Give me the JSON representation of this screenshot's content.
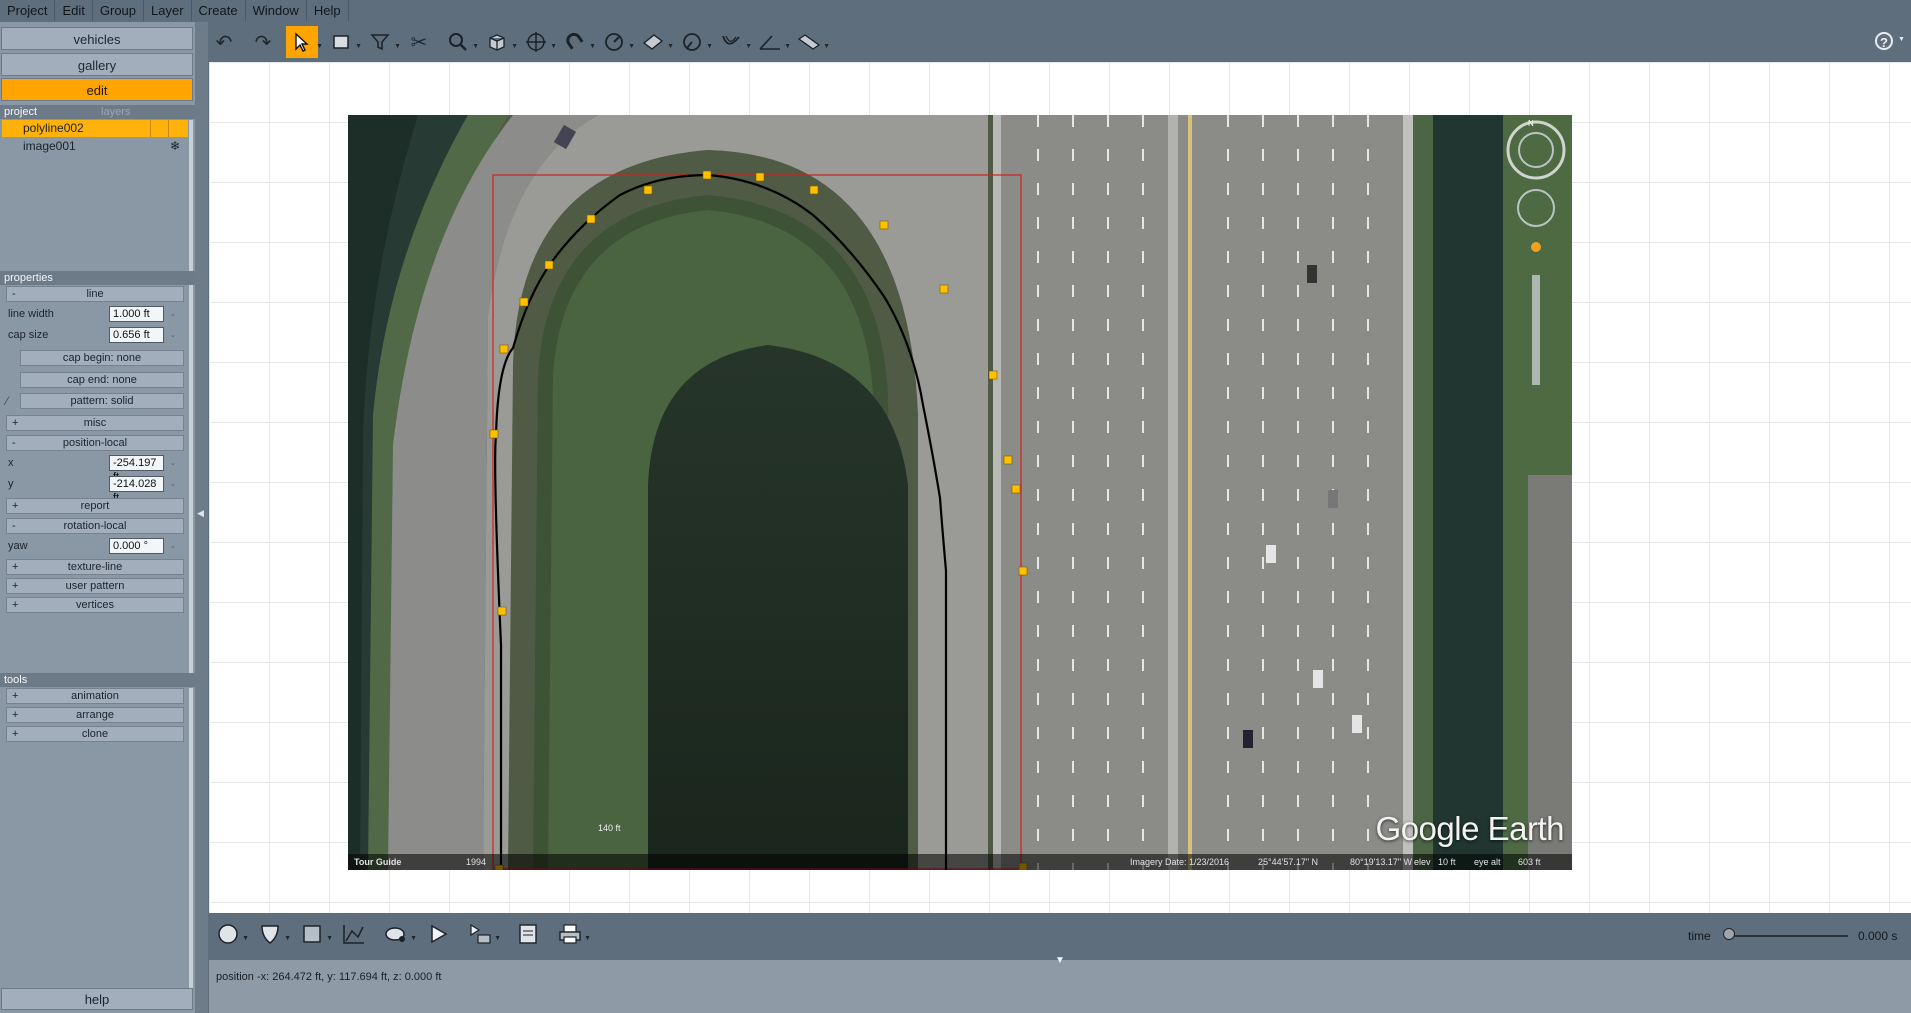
{
  "menu": [
    "Project",
    "Edit",
    "Group",
    "Layer",
    "Create",
    "Window",
    "Help"
  ],
  "nav": {
    "vehicles": "vehicles",
    "gallery": "gallery",
    "edit": "edit"
  },
  "project_panel": {
    "tab_project": "project",
    "tab_layers": "layers",
    "items": [
      {
        "label": "polyline002",
        "selected": true
      },
      {
        "label": "image001",
        "selected": false
      }
    ]
  },
  "properties": {
    "title": "properties",
    "line_group": "line",
    "line_width_label": "line width",
    "line_width_value": "1.000 ft",
    "cap_size_label": "cap size",
    "cap_size_value": "0.656 ft",
    "cap_begin": "cap begin: none",
    "cap_end": "cap end: none",
    "pattern": "pattern: solid",
    "misc": "misc",
    "position_local": "position-local",
    "x_label": "x",
    "x_value": "-254.197 ft",
    "y_label": "y",
    "y_value": "-214.028 ft",
    "report": "report",
    "rotation_local": "rotation-local",
    "yaw_label": "yaw",
    "yaw_value": "0.000 °",
    "texture_line": "texture-line",
    "user_pattern": "user pattern",
    "vertices": "vertices"
  },
  "tools_panel": {
    "title": "tools",
    "animation": "animation",
    "arrange": "arrange",
    "clone": "clone"
  },
  "help_label": "help",
  "time": {
    "label": "time",
    "value": "0.000 s",
    "position": 0.0
  },
  "status": "position -x: 264.472 ft, y: 117.694 ft, z: 0.000 ft",
  "google_earth": {
    "logo": "Google Earth",
    "tour_guide": "Tour Guide",
    "year": "1994",
    "scale": "140 ft",
    "imagery_date": "Imagery Date: 1/23/2016",
    "lat": "25°44'57.17\" N",
    "lon": "80°19'13.17\" W",
    "elev": "elev",
    "elev_value": "10 ft",
    "eye_alt": "eye alt",
    "eye_alt_value": "603 ft",
    "compass_n": "N"
  },
  "colors": {
    "accent": "#ffa400",
    "panel": "#8a97a4",
    "button": "#a2aebb",
    "polyline": "#000000",
    "vertex": "#ffc000",
    "bbox": "#d42020"
  },
  "icons": {
    "toolbar": [
      "undo-icon",
      "redo-icon",
      "select-arrow-icon",
      "rectangle-select-icon",
      "filter-funnel-icon",
      "scissors-icon",
      "zoom-icon",
      "cube-view-icon",
      "pan-crosshair-icon",
      "magnet-icon",
      "dial-measure-icon",
      "plane-icon",
      "protractor-icon",
      "curve-tool-icon",
      "angle-measure-icon",
      "ruler-icon"
    ],
    "bottom": [
      "circle-shape-icon",
      "shield-shape-icon",
      "square-shape-icon",
      "graph-icon",
      "paint-bucket-icon",
      "play-icon",
      "playlist-icon",
      "panel-icon",
      "print-icon"
    ]
  }
}
